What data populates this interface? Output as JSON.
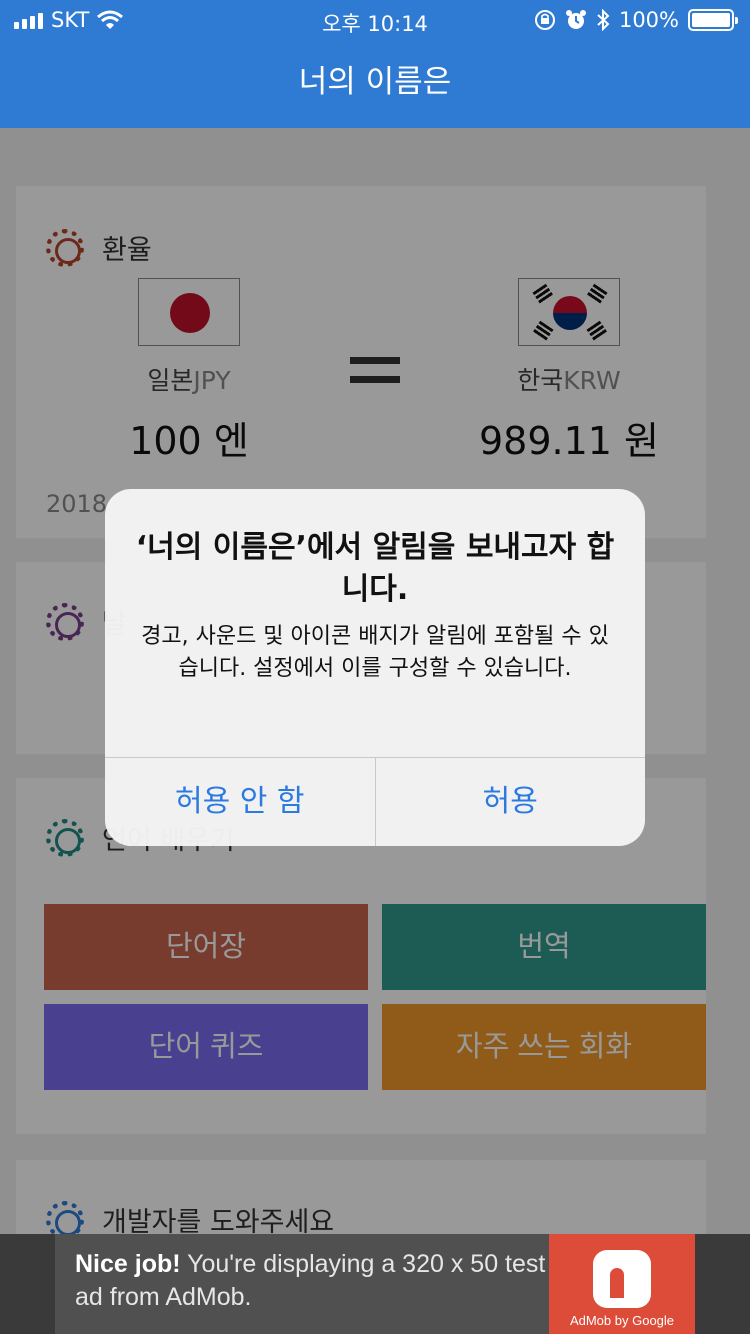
{
  "status_bar": {
    "carrier": "SKT",
    "time": "오후 10:14",
    "battery": "100%"
  },
  "nav": {
    "title": "너의 이름은"
  },
  "exchange": {
    "title": "환율",
    "from": {
      "name": "일본",
      "code": "JPY",
      "amount": "100 엔"
    },
    "to": {
      "name": "한국",
      "code": "KRW",
      "amount": "989.11 원"
    },
    "date_partial": "2018"
  },
  "section2": {
    "title_partial": "날"
  },
  "learn": {
    "title_partial": "언어 배우기",
    "buttons": [
      {
        "label": "단어장",
        "color": "#c8654d"
      },
      {
        "label": "번역",
        "color": "#2f9a8e"
      },
      {
        "label": "단어 퀴즈",
        "color": "#7a6bf0"
      },
      {
        "label": "자주 쓰는 회화",
        "color": "#f0982a"
      }
    ]
  },
  "help": {
    "title": "개발자를 도와주세요"
  },
  "alert": {
    "title": "‘너의 이름은’에서 알림을 보내고자 합니다.",
    "message": "경고, 사운드 및 아이콘 배지가 알림에 포함될 수 있습니다. 설정에서 이를 구성할 수 있습니다.",
    "deny": "허용 안 함",
    "allow": "허용"
  },
  "ad": {
    "headline": "Nice job!",
    "body": " You're displaying a 320 x 50 test ad from AdMob.",
    "brand": "AdMob by Google"
  },
  "colors": {
    "primary": "#2f7bd3",
    "alert_button": "#2a7ae2",
    "gear_exchange": "#b5452c",
    "gear_section2": "#7b3f8c",
    "gear_learn": "#1e8a84",
    "gear_help": "#2f7bd3"
  },
  "icons": [
    "signal-icon",
    "wifi-icon",
    "lock-rotation-icon",
    "alarm-icon",
    "bluetooth-icon",
    "battery-icon",
    "gear-icon",
    "japan-flag-icon",
    "korea-flag-icon",
    "equals-icon",
    "admob-logo-icon"
  ]
}
